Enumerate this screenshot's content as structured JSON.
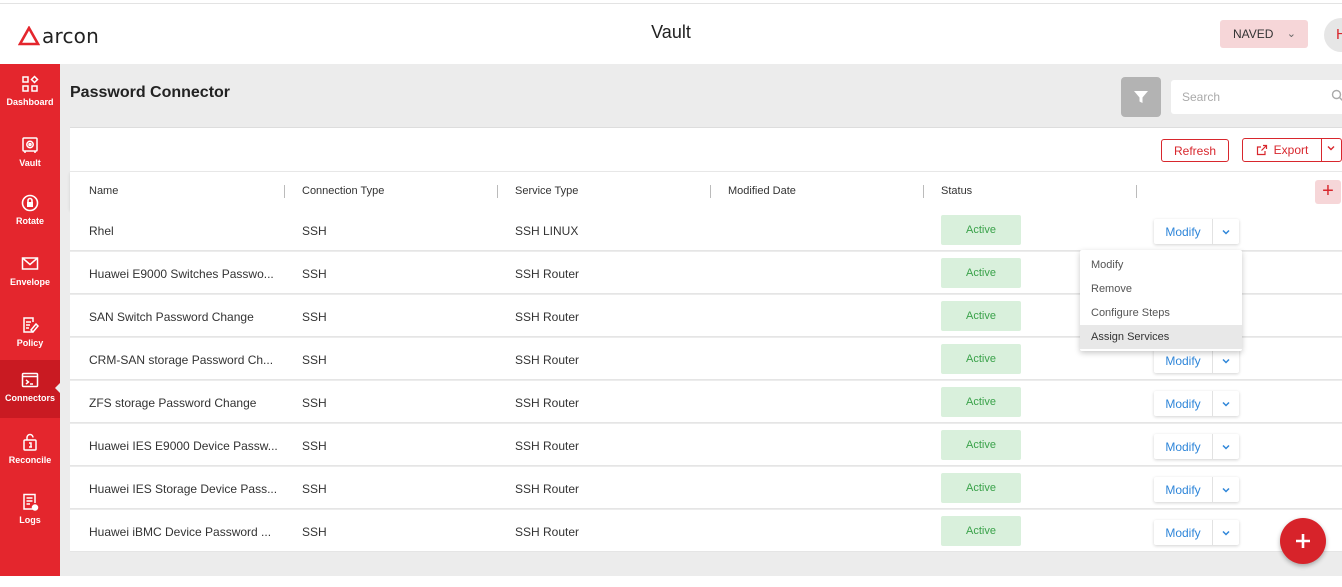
{
  "header": {
    "logo_text": "arcon",
    "title": "Vault",
    "user_name": "NAVED",
    "avatar_initial": "H"
  },
  "sidebar": {
    "items": [
      {
        "label": "Dashboard",
        "icon": "dashboard-icon"
      },
      {
        "label": "Vault",
        "icon": "vault-icon"
      },
      {
        "label": "Rotate",
        "icon": "rotate-icon"
      },
      {
        "label": "Envelope",
        "icon": "envelope-icon"
      },
      {
        "label": "Policy",
        "icon": "policy-icon"
      },
      {
        "label": "Connectors",
        "icon": "terminal-icon",
        "active": true
      },
      {
        "label": "Reconcile",
        "icon": "reconcile-icon"
      },
      {
        "label": "Logs",
        "icon": "logs-icon"
      }
    ]
  },
  "main": {
    "page_title": "Password Connector",
    "search": {
      "placeholder": "Search"
    },
    "toolbar": {
      "refresh_label": "Refresh",
      "export_label": "Export"
    },
    "table": {
      "columns": [
        "Name",
        "Connection Type",
        "Service Type",
        "Modified Date",
        "Status"
      ],
      "rows": [
        {
          "name": "Rhel",
          "connection_type": "SSH",
          "service_type": "SSH LINUX",
          "modified_date": "",
          "status": "Active",
          "action": "Modify"
        },
        {
          "name": "Huawei E9000 Switches Passwo...",
          "connection_type": "SSH",
          "service_type": "SSH Router",
          "modified_date": "",
          "status": "Active",
          "action": "Modify"
        },
        {
          "name": "SAN Switch Password Change",
          "connection_type": "SSH",
          "service_type": "SSH Router",
          "modified_date": "",
          "status": "Active",
          "action": "Modify"
        },
        {
          "name": "CRM-SAN storage Password Ch...",
          "connection_type": "SSH",
          "service_type": "SSH Router",
          "modified_date": "",
          "status": "Active",
          "action": "Modify"
        },
        {
          "name": "ZFS storage Password Change",
          "connection_type": "SSH",
          "service_type": "SSH Router",
          "modified_date": "",
          "status": "Active",
          "action": "Modify"
        },
        {
          "name": "Huawei IES E9000 Device Passw...",
          "connection_type": "SSH",
          "service_type": "SSH Router",
          "modified_date": "",
          "status": "Active",
          "action": "Modify"
        },
        {
          "name": "Huawei IES Storage Device Pass...",
          "connection_type": "SSH",
          "service_type": "SSH Router",
          "modified_date": "",
          "status": "Active",
          "action": "Modify"
        },
        {
          "name": "Huawei iBMC Device Password ...",
          "connection_type": "SSH",
          "service_type": "SSH Router",
          "modified_date": "",
          "status": "Active",
          "action": "Modify"
        }
      ]
    },
    "action_menu": {
      "items": [
        "Modify",
        "Remove",
        "Configure Steps",
        "Assign Services"
      ],
      "highlighted": "Assign Services"
    }
  },
  "colors": {
    "brand_red": "#e4262d",
    "active_green_bg": "#d9f0dc",
    "active_green_text": "#3aa24a",
    "link_blue": "#2f86d9"
  }
}
